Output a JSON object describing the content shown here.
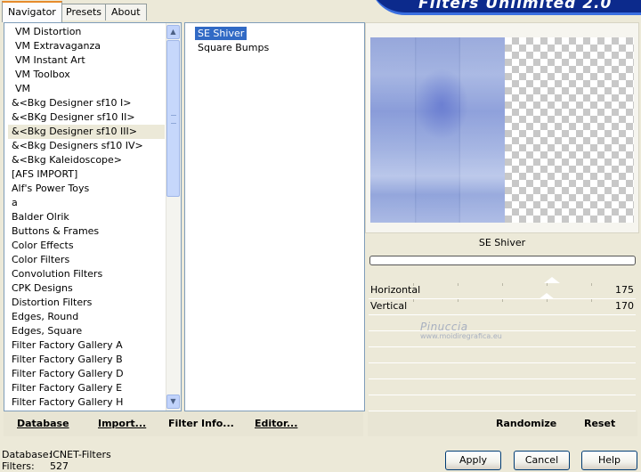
{
  "tabs": [
    "Navigator",
    "Presets",
    "About"
  ],
  "banner": "Filters Unlimited 2.0",
  "categories": [
    "VM Distortion",
    "VM Extravaganza",
    "VM Instant Art",
    "VM Toolbox",
    "VM",
    "&<Bkg Designer sf10 I>",
    "&<BKg Designer sf10 II>",
    "&<Bkg Designer sf10 III>",
    "&<Bkg Designers sf10 IV>",
    "&<Bkg Kaleidoscope>",
    "[AFS IMPORT]",
    "Alf's Power Toys",
    "a",
    "Balder Olrik",
    "Buttons & Frames",
    "Color Effects",
    "Color Filters",
    "Convolution Filters",
    "CPK Designs",
    "Distortion Filters",
    "Edges, Round",
    "Edges, Square",
    "Filter Factory Gallery A",
    "Filter Factory Gallery B",
    "Filter Factory Gallery D",
    "Filter Factory Gallery E",
    "Filter Factory Gallery H"
  ],
  "selected_category": "&<Bkg Designer sf10 III>",
  "filters": [
    "SE Shiver",
    "Square Bumps"
  ],
  "selected_filter": "SE Shiver",
  "filter_title": "SE Shiver",
  "params": [
    {
      "label": "Horizontal",
      "value": "175",
      "level": 0.686
    },
    {
      "label": "Vertical",
      "value": "170",
      "level": 0.667
    }
  ],
  "watermark": {
    "name": "Pinuccia",
    "url": "www.moidiregrafica.eu"
  },
  "toolbar": {
    "database": "Database",
    "import": "Import...",
    "filter_info": "Filter Info...",
    "editor": "Editor...",
    "randomize": "Randomize",
    "reset": "Reset"
  },
  "status": {
    "database_label": "Database:",
    "database_value": "ICNET-Filters",
    "filters_label": "Filters:",
    "filters_value": "527"
  },
  "buttons": {
    "apply": "Apply",
    "cancel": "Cancel",
    "help": "Help"
  },
  "colors": {
    "selection": "#316ac5",
    "banner": "#0c2a8c",
    "tab_accent": "#e68b2c"
  }
}
